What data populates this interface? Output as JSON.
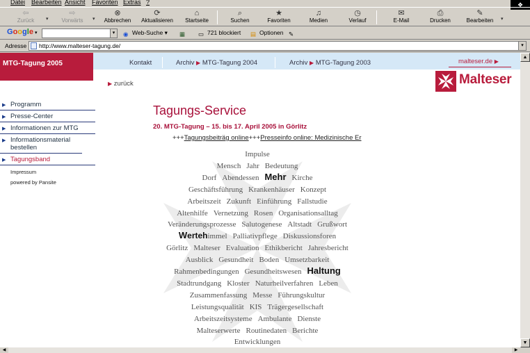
{
  "menubar": {
    "items": [
      "Datei",
      "Bearbeiten",
      "Ansicht",
      "Favoriten",
      "Extras",
      "?"
    ]
  },
  "toolbar": {
    "back": "Zurück",
    "forward": "Vorwärts",
    "stop": "Abbrechen",
    "refresh": "Aktualisieren",
    "home": "Startseite",
    "search": "Suchen",
    "favorites": "Favoriten",
    "media": "Medien",
    "history": "Verlauf",
    "mail": "E-Mail",
    "print": "Drucken",
    "edit": "Bearbeiten"
  },
  "google_bar": {
    "logo": "Google",
    "search_placeholder": "",
    "web_search": "Web-Suche",
    "blocked": "721 blockiert",
    "options": "Optionen"
  },
  "address_bar": {
    "label": "Adresse",
    "url": "http://www.malteser-tagung.de/"
  },
  "site": {
    "brand": "MTG-Tagung 2005",
    "nav": {
      "kontakt": "Kontakt",
      "archiv2004": "Archiv",
      "archiv2004_target": "MTG-Tagung 2004",
      "archiv2003": "Archiv",
      "archiv2003_target": "MTG-Tagung 2003",
      "malteser_link": "malteser.de"
    },
    "back": "zurück",
    "logo": "Malteser",
    "sidebar": [
      {
        "label": "Programm"
      },
      {
        "label": "Presse-Center"
      },
      {
        "label": "Informationen zur MTG"
      },
      {
        "label": "Informationsmaterial bestellen"
      },
      {
        "label": "Tagungsband"
      }
    ],
    "sidebar_small": [
      "Impressum",
      "powered by Pansite"
    ],
    "title": "Tagungs-Service",
    "subtitle": "20. MTG-Tagung – 15. bis 17. April 2005 in Görlitz",
    "ticker": {
      "prefix": "+++",
      "link1": "Tagungsbeiträg online",
      "sep": "+++",
      "link2": "Presseinfo online: Medizinische Er"
    },
    "cloud": {
      "lines": [
        [
          "Impulse"
        ],
        [
          "Mensch",
          "Jahr",
          "Bedeutung"
        ],
        [
          "Dorf",
          "Abendessen",
          "Mehr",
          "Kirche"
        ],
        [
          "Geschäftsführung",
          "Krankenhäuser",
          "Konzept"
        ],
        [
          "Arbeitszeit",
          "Zukunft",
          "Einführung",
          "Fallstudie"
        ],
        [
          "Altenhilfe",
          "Vernetzung",
          "Rosen",
          "Organisationsalltag"
        ],
        [
          "Veränderungsprozesse",
          "Salutogenese",
          "Altstadt",
          "Grußwort"
        ],
        [
          "Werteh",
          "immel",
          "Palliativpflege",
          "Diskussionsforen"
        ],
        [
          "Görlitz",
          "Malteser",
          "Evaluation",
          "Ethikbericht",
          "Jahresbericht"
        ],
        [
          "Ausblick",
          "Gesundheit",
          "Boden",
          "Umsetzbarkeit"
        ],
        [
          "Rahmenbedingungen",
          "Gesundheitswesen",
          "Haltung"
        ],
        [
          "Stadtrundgang",
          "Kloster",
          "Naturheilverfahren",
          "Leben"
        ],
        [
          "Zusammenfassung",
          "Messe",
          "Führungskultur"
        ],
        [
          "Leistungsqualität",
          "KIS",
          "Trägergesellschaft"
        ],
        [
          "Arbeitszeitsysteme",
          "Ambulante",
          "Dienste"
        ],
        [
          "Malteserwerte",
          "Routinedaten",
          "Berichte"
        ],
        [
          "Entwicklungen"
        ]
      ]
    }
  }
}
